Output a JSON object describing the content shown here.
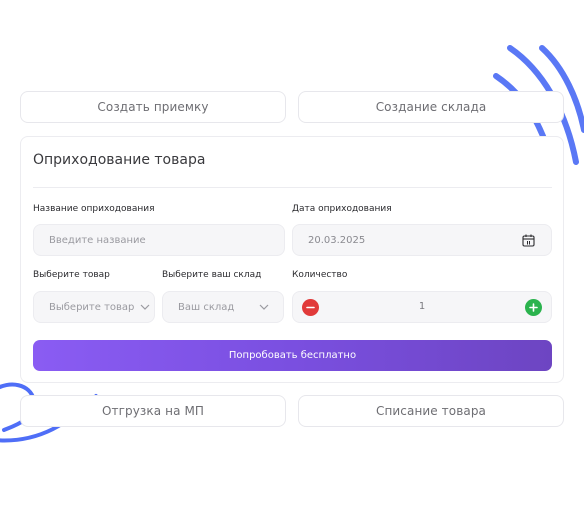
{
  "top_tabs": [
    {
      "label": "Создать приемку"
    },
    {
      "label": "Создание склада"
    }
  ],
  "form": {
    "title": "Оприходование товара",
    "name_label": "Название оприходования",
    "name_placeholder": "Введите название",
    "date_label": "Дата оприходования",
    "date_value": "20.03.2025",
    "product_label": "Выберите товар",
    "product_value": "Выберите товар",
    "warehouse_label": "Выберите ваш склад",
    "warehouse_value": "Ваш склад",
    "quantity_label": "Количество",
    "quantity_value": "1",
    "cta_label": "Попробовать бесплатно"
  },
  "bottom_tabs": [
    {
      "label": "Отгрузка на МП"
    },
    {
      "label": "Списание товара"
    }
  ],
  "colors": {
    "accent_gradient_start": "#8a5cf3",
    "accent_gradient_end": "#6d45c2",
    "decor_blue": "#4f6ef7",
    "minus_red": "#e13a3a",
    "plus_green": "#2bb34e"
  },
  "icons": [
    "calendar-icon",
    "chevron-down-icon",
    "minus-icon",
    "plus-icon"
  ]
}
